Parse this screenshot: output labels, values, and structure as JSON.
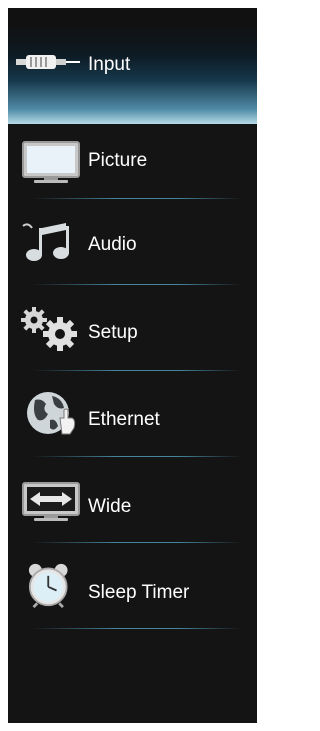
{
  "menu": {
    "items": [
      {
        "label": "Input",
        "icon": "cable-plug-icon",
        "selected": true
      },
      {
        "label": "Picture",
        "icon": "monitor-icon",
        "selected": false
      },
      {
        "label": "Audio",
        "icon": "music-note-icon",
        "selected": false
      },
      {
        "label": "Setup",
        "icon": "gears-icon",
        "selected": false
      },
      {
        "label": "Ethernet",
        "icon": "globe-hand-icon",
        "selected": false
      },
      {
        "label": "Wide",
        "icon": "widescreen-icon",
        "selected": false
      },
      {
        "label": "Sleep Timer",
        "icon": "alarm-clock-icon",
        "selected": false
      }
    ]
  },
  "colors": {
    "background": "#141414",
    "text": "#ffffff",
    "accent": "#4f8aa6"
  }
}
